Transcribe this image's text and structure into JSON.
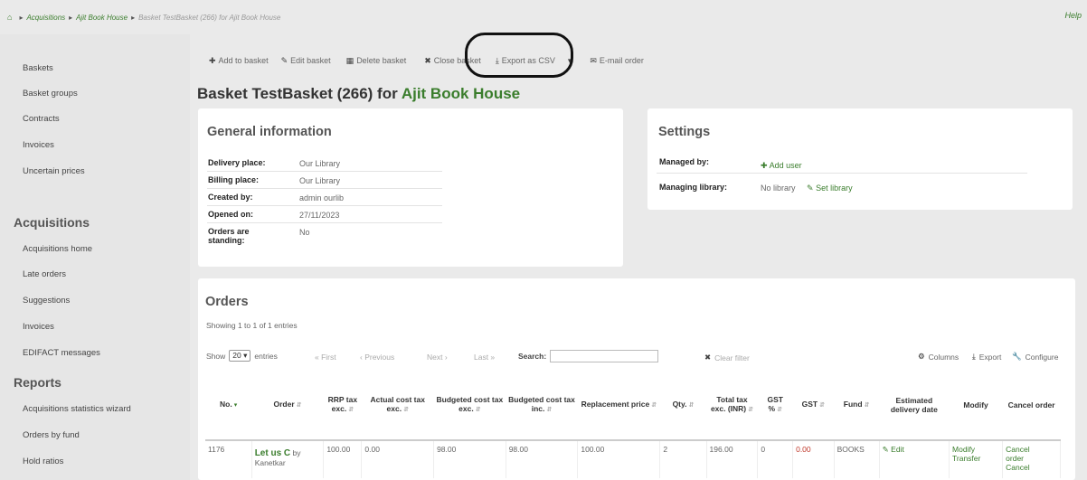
{
  "breadcrumb": {
    "items": [
      "Acquisitions",
      "Ajit Book House"
    ],
    "current": "Basket TestBasket (266) for Ajit Book House",
    "help": "Help"
  },
  "sidebar": {
    "top_items": [
      "Baskets",
      "Basket groups",
      "Contracts",
      "Invoices",
      "Uncertain prices"
    ],
    "acquisitions_heading": "Acquisitions",
    "acquisitions_items": [
      "Acquisitions home",
      "Late orders",
      "Suggestions",
      "Invoices",
      "EDIFACT messages"
    ],
    "reports_heading": "Reports",
    "reports_items": [
      "Acquisitions statistics wizard",
      "Orders by fund",
      "Hold ratios"
    ]
  },
  "toolbar": {
    "add_to_basket": "Add to basket",
    "edit_basket": "Edit basket",
    "delete_basket": "Delete basket",
    "close_basket": "Close basket",
    "export_csv": "Export as CSV",
    "email_order": "E-mail order"
  },
  "title": {
    "prefix": "Basket TestBasket (266) for",
    "vendor": "Ajit Book House"
  },
  "general": {
    "heading": "General information",
    "rows": [
      {
        "label": "Delivery place:",
        "value": "Our Library"
      },
      {
        "label": "Billing place:",
        "value": "Our Library"
      },
      {
        "label": "Created by:",
        "value": "admin ourlib"
      },
      {
        "label": "Opened on:",
        "value": "27/11/2023"
      },
      {
        "label": "Orders are standing:",
        "value": "No"
      }
    ]
  },
  "settings": {
    "heading": "Settings",
    "managed_by_label": "Managed by:",
    "add_user": "Add user",
    "managing_library_label": "Managing library:",
    "managing_library_value": "No library",
    "set_library": "Set library"
  },
  "orders": {
    "heading": "Orders",
    "showing": "Showing 1 to 1 of 1 entries",
    "show_label": "Show",
    "page_size": "20",
    "entries_label": "entries",
    "first": "« First",
    "previous": "‹ Previous",
    "next": "Next ›",
    "last": "Last »",
    "search_label": "Search:",
    "clear_filter": "Clear filter",
    "columns_btn": "Columns",
    "export_btn": "Export",
    "configure_btn": "Configure",
    "headers": [
      "No.",
      "Order",
      "RRP tax exc.",
      "Actual cost tax exc.",
      "Budgeted cost tax exc.",
      "Budgeted cost tax inc.",
      "Replacement price",
      "Qty.",
      "Total tax exc. (INR)",
      "GST %",
      "GST",
      "Fund",
      "Estimated delivery date",
      "Modify",
      "Cancel order"
    ],
    "row": {
      "no": "1176",
      "title": "Let us C",
      "by": "by",
      "author": "Kanetkar",
      "rrp": "100.00",
      "actual": "0.00",
      "budget_exc": "98.00",
      "budget_inc": "98.00",
      "replacement": "100.00",
      "qty": "2",
      "total": "196.00",
      "gst_pct": "0",
      "gst": "0.00",
      "fund": "BOOKS",
      "edit": "Edit",
      "modify": "Modify",
      "transfer": "Transfer",
      "cancel1": "Cancel",
      "cancel2": "order",
      "cancel3": "Cancel"
    }
  },
  "colors": {
    "link_green": "#3a7d2c",
    "gst_red": "#c0392b",
    "annotation_circle": "#111111"
  }
}
